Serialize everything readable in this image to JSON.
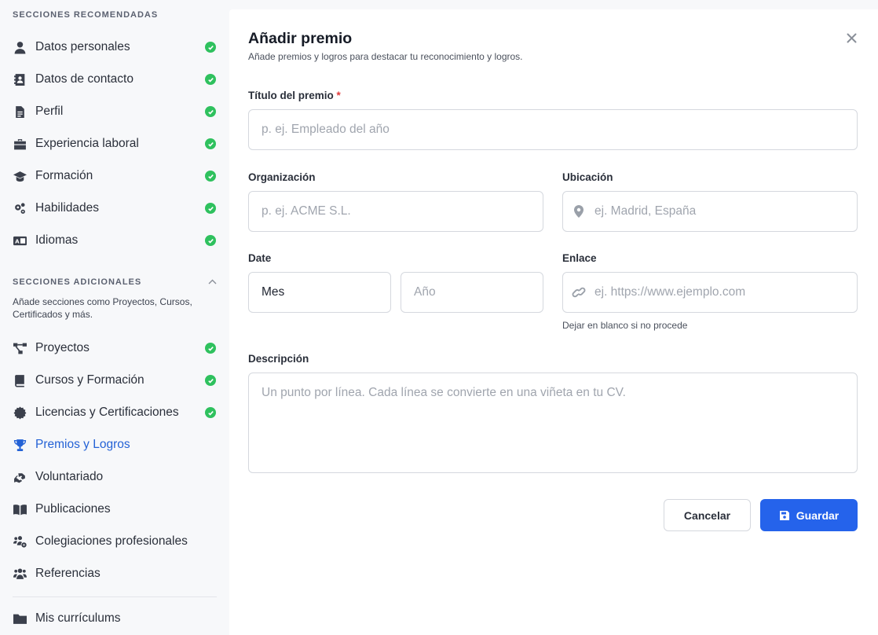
{
  "sidebar": {
    "recommended_heading": "SECCIONES RECOMENDADAS",
    "recommended": [
      {
        "label": "Datos personales",
        "icon": "user-icon",
        "done": true
      },
      {
        "label": "Datos de contacto",
        "icon": "contact-card-icon",
        "done": true
      },
      {
        "label": "Perfil",
        "icon": "document-icon",
        "done": true
      },
      {
        "label": "Experiencia laboral",
        "icon": "briefcase-icon",
        "done": true
      },
      {
        "label": "Formación",
        "icon": "graduation-cap-icon",
        "done": true
      },
      {
        "label": "Habilidades",
        "icon": "gears-icon",
        "done": true
      },
      {
        "label": "Idiomas",
        "icon": "language-icon",
        "done": true
      }
    ],
    "additional_heading": "SECCIONES ADICIONALES",
    "additional_desc": "Añade secciones como Proyectos, Cursos, Certificados y más.",
    "additional": [
      {
        "label": "Proyectos",
        "icon": "project-diagram-icon",
        "done": true
      },
      {
        "label": "Cursos y Formación",
        "icon": "book-icon",
        "done": true
      },
      {
        "label": "Licencias y Certificaciones",
        "icon": "certificate-icon",
        "done": true
      },
      {
        "label": "Premios y Logros",
        "icon": "trophy-icon",
        "done": false,
        "active": true
      },
      {
        "label": "Voluntariado",
        "icon": "hands-helping-icon",
        "done": false
      },
      {
        "label": "Publicaciones",
        "icon": "open-book-icon",
        "done": false
      },
      {
        "label": "Colegiaciones profesionales",
        "icon": "users-cog-icon",
        "done": false
      },
      {
        "label": "Referencias",
        "icon": "users-icon",
        "done": false
      }
    ],
    "my_resumes": "Mis currículums"
  },
  "modal": {
    "title": "Añadir premio",
    "subtitle": "Añade premios y logros para destacar tu reconocimiento y logros.",
    "award_title_label": "Título del premio",
    "required_mark": "*",
    "award_title_placeholder": "p. ej. Empleado del año",
    "organization_label": "Organización",
    "organization_placeholder": "p. ej. ACME S.L.",
    "location_label": "Ubicación",
    "location_placeholder": "ej. Madrid, España",
    "date_label": "Date",
    "month_value": "Mes",
    "year_placeholder": "Año",
    "link_label": "Enlace",
    "link_placeholder": "ej. https://www.ejemplo.com",
    "link_hint": "Dejar en blanco si no procede",
    "description_label": "Descripción",
    "description_placeholder": "Un punto por línea. Cada línea se convierte en una viñeta en tu CV.",
    "cancel_label": "Cancelar",
    "save_label": "Guardar"
  },
  "colors": {
    "accent": "#2563eb",
    "active_nav": "#2462d6",
    "check": "#2fc15e",
    "required": "#e03a3a"
  }
}
